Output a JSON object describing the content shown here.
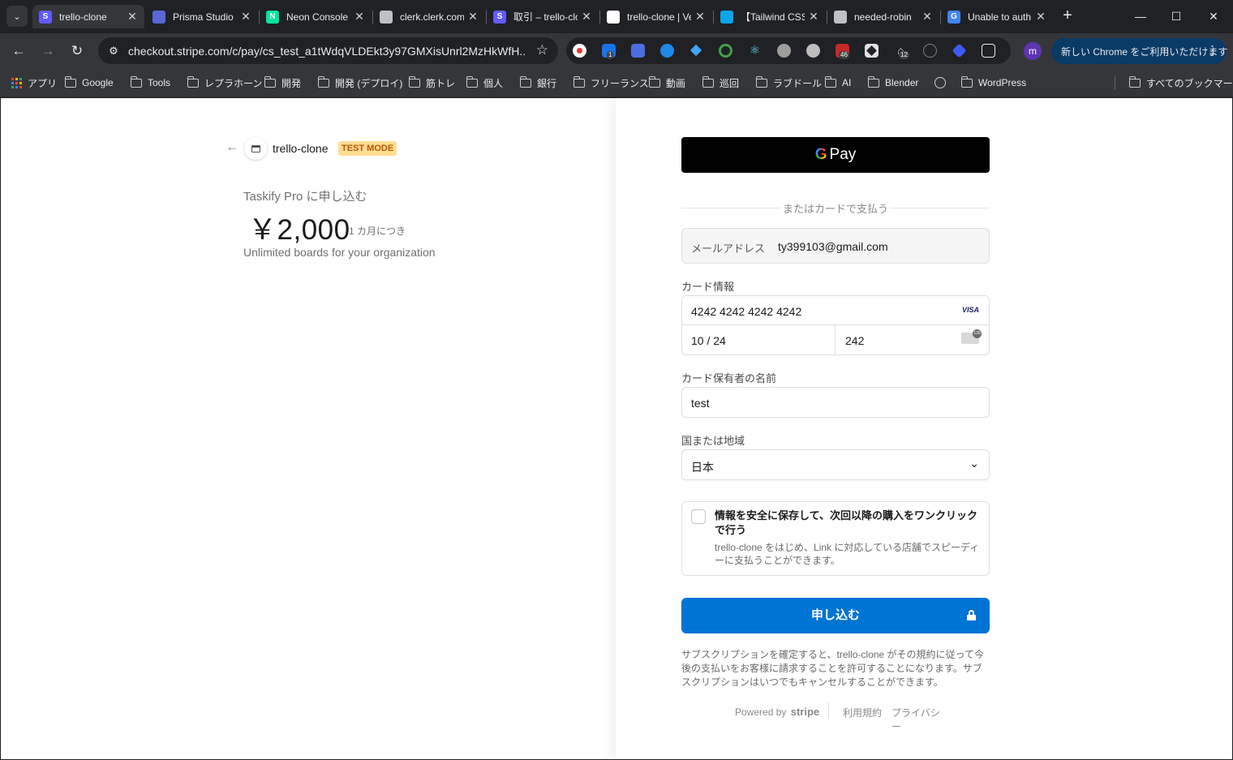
{
  "browser": {
    "tabs": [
      {
        "title": "trello-clone",
        "favicon_color": "#635bff",
        "favicon_letter": "S",
        "active": true
      },
      {
        "title": "Prisma Studio",
        "favicon_color": "#5a67d8",
        "favicon_letter": "",
        "active": false
      },
      {
        "title": "Neon Console",
        "favicon_color": "#00e599",
        "favicon_letter": "N",
        "active": false
      },
      {
        "title": "clerk.clerk.com",
        "favicon_color": "#bdc1c6",
        "favicon_letter": "",
        "active": false
      },
      {
        "title": "取引 – trello-clone",
        "favicon_color": "#635bff",
        "favicon_letter": "S",
        "active": false
      },
      {
        "title": "trello-clone | Vercel",
        "favicon_color": "#ffffff",
        "favicon_letter": "",
        "active": false
      },
      {
        "title": "【Tailwind CSS】",
        "favicon_color": "#0ea5e9",
        "favicon_letter": "",
        "active": false
      },
      {
        "title": "needed-robin",
        "favicon_color": "#bdc1c6",
        "favicon_letter": "",
        "active": false
      },
      {
        "title": "Unable to auth",
        "favicon_color": "#4285f4",
        "favicon_letter": "G",
        "active": false
      }
    ],
    "url": "checkout.stripe.com/c/pay/cs_test_a1tWdqVLDEkt3y97GMXisUnrl2MzHkWfH...",
    "profile_letter": "m",
    "update_label": "新しい Chrome をご利用いただけます",
    "extension_badges": [
      "1",
      "46",
      "12"
    ],
    "bookmarks": [
      {
        "label": "アプリ",
        "kind": "apps"
      },
      {
        "label": "Google",
        "kind": "folder"
      },
      {
        "label": "Tools",
        "kind": "folder"
      },
      {
        "label": "レプラホーン",
        "kind": "folder"
      },
      {
        "label": "開発",
        "kind": "folder"
      },
      {
        "label": "開発 (デプロイ)",
        "kind": "folder"
      },
      {
        "label": "筋トレ",
        "kind": "folder"
      },
      {
        "label": "個人",
        "kind": "folder"
      },
      {
        "label": "銀行",
        "kind": "folder"
      },
      {
        "label": "フリーランス",
        "kind": "folder"
      },
      {
        "label": "動画",
        "kind": "folder"
      },
      {
        "label": "巡回",
        "kind": "folder"
      },
      {
        "label": "ラブドール",
        "kind": "folder"
      },
      {
        "label": "AI",
        "kind": "folder"
      },
      {
        "label": "Blender",
        "kind": "folder"
      },
      {
        "label": "",
        "kind": "globe"
      },
      {
        "label": "WordPress",
        "kind": "folder"
      }
    ],
    "all_bookmarks_label": "すべてのブックマーク"
  },
  "summary": {
    "business_name": "trello-clone",
    "test_mode_label": "TEST MODE",
    "product_title": "Taskify Pro に申し込む",
    "price": "￥2,000",
    "price_period": "1 カ月につき",
    "description": "Unlimited boards for your organization"
  },
  "checkout": {
    "gpay_label": "Pay",
    "divider_text": "またはカードで支払う",
    "email_label": "メールアドレス",
    "email_value": "ty399103@gmail.com",
    "card_label": "カード情報",
    "card_number": "4242 4242 4242 4242",
    "card_brand": "VISA",
    "card_expiry": "10 / 24",
    "card_cvc": "242",
    "cardholder_label": "カード保有者の名前",
    "cardholder_value": "test",
    "country_label": "国または地域",
    "country_value": "日本",
    "save_info_title": "情報を安全に保存して、次回以降の購入をワンクリックで行う",
    "save_info_sub": "trello-clone をはじめ、Link に対応している店舗でスピーディーに支払うことができます。",
    "submit_label": "申し込む",
    "terms": "サブスクリプションを確定すると、trello-clone がその規約に従って今後の支払いをお客様に請求することを許可することになります。サブスクリプションはいつでもキャンセルすることができます。",
    "powered_by": "Powered by",
    "stripe_word": "stripe",
    "terms_link": "利用規約",
    "privacy_link": "プライバシー"
  }
}
